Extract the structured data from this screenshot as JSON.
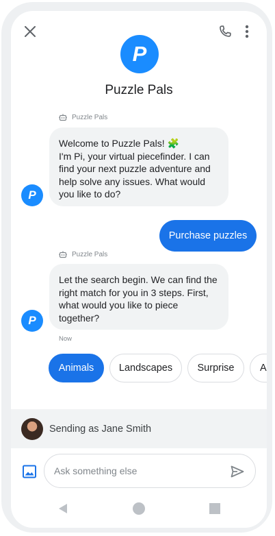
{
  "header": {
    "brand_initial": "P",
    "brand_name": "Puzzle Pals",
    "close_icon": "close-icon",
    "call_icon": "phone-icon",
    "menu_icon": "more-vert-icon"
  },
  "messages": [
    {
      "sender": "Puzzle Pals",
      "text": "Welcome to Puzzle Pals! 🧩\nI'm Pi, your virtual piecefinder. I can find your next puzzle adventure and help solve any issues. What would you like to do?"
    },
    {
      "sender": "Puzzle Pals",
      "text": "Let the search begin. We can find the right match for you in 3 steps. First, what would you like to piece together?"
    }
  ],
  "outgoing": {
    "text": "Purchase puzzles"
  },
  "timestamp": "Now",
  "chips": [
    {
      "label": "Animals"
    },
    {
      "label": "Landscapes"
    },
    {
      "label": "Surprise"
    },
    {
      "label": "A"
    }
  ],
  "sending_as": "Sending as Jane Smith",
  "compose": {
    "placeholder": "Ask something else"
  },
  "colors": {
    "brand": "#1a8cff",
    "primary": "#1a73e8",
    "bubble_bg": "#f1f3f4"
  }
}
